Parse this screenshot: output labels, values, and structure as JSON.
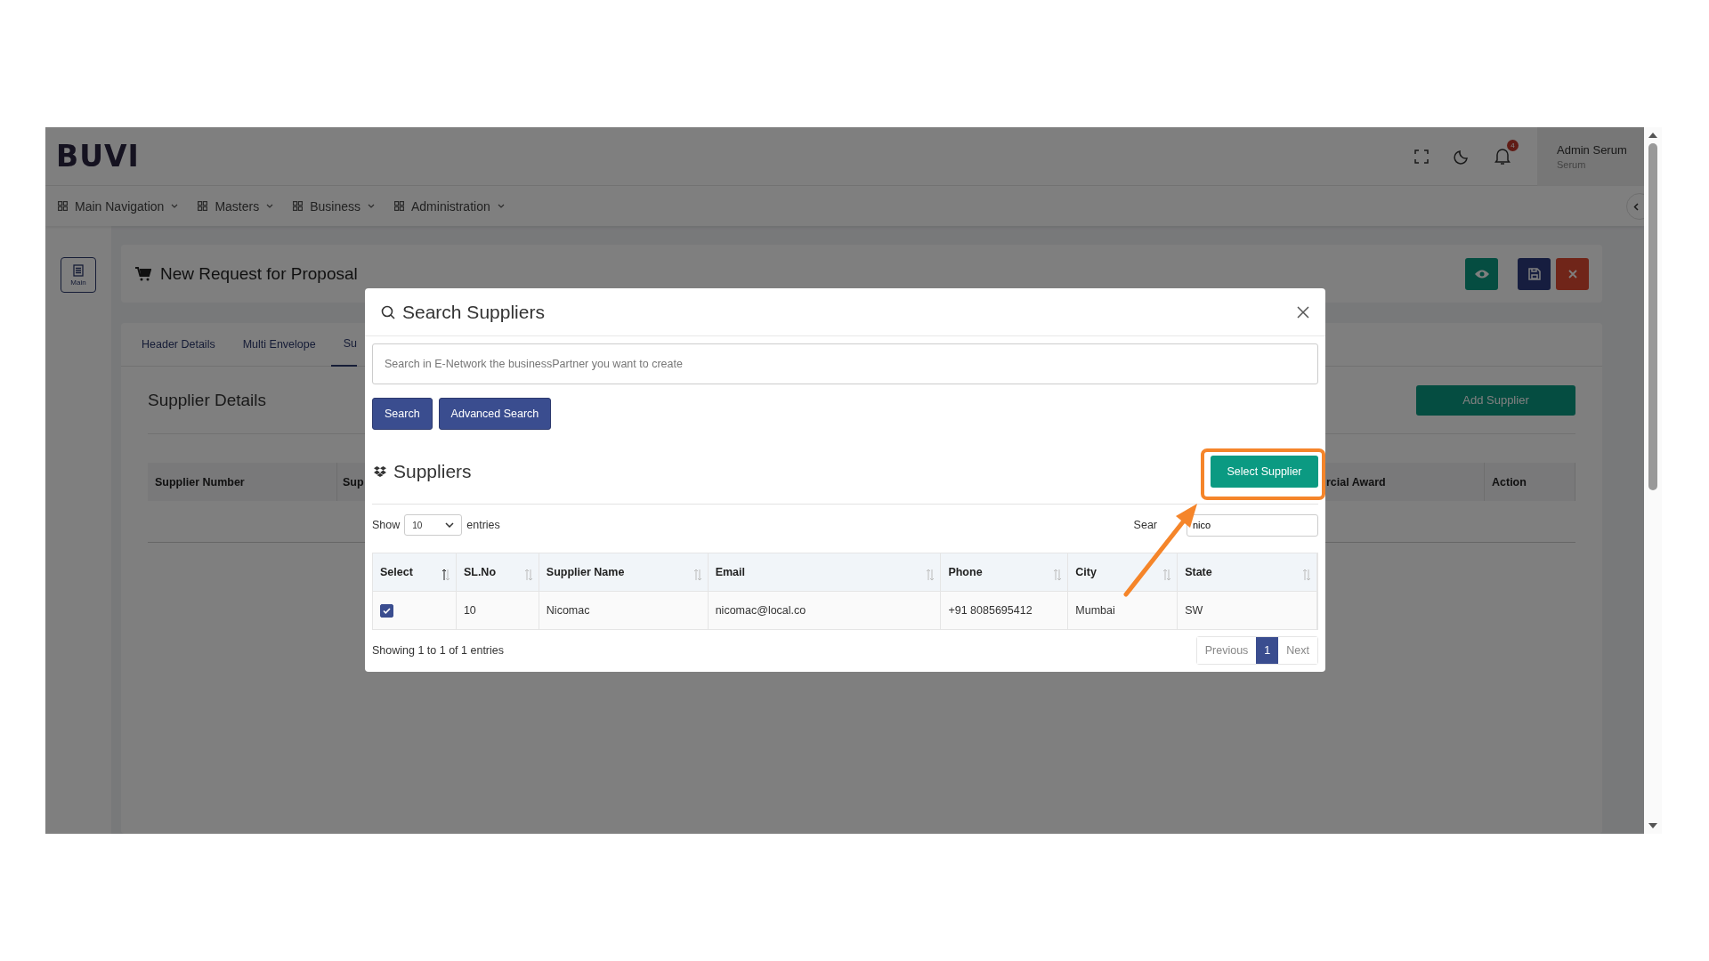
{
  "app": {
    "logo": "BUVI",
    "notifications": "4",
    "user": {
      "name": "Admin Serum",
      "role": "Serum"
    }
  },
  "nav": [
    {
      "label": "Main Navigation"
    },
    {
      "label": "Masters"
    },
    {
      "label": "Business"
    },
    {
      "label": "Administration"
    }
  ],
  "sidebar": {
    "button": "Main"
  },
  "page": {
    "title": "New Request for Proposal",
    "actions": [
      {
        "kind": "view"
      },
      {
        "kind": "save"
      },
      {
        "kind": "close"
      }
    ]
  },
  "tabs": [
    {
      "label": "Header Details",
      "selected": false
    },
    {
      "label": "Multi Envelope",
      "selected": false
    },
    {
      "label": "Su",
      "selected": true
    }
  ],
  "section": {
    "title": "Supplier Details",
    "add_button": "Add Supplier",
    "columns": [
      "Supplier Number",
      "Sup",
      "rcial Award",
      "Action"
    ]
  },
  "modal": {
    "title": "Search Suppliers",
    "search_placeholder": "Search in E-Network the businessPartner you want to create",
    "buttons": [
      "Search",
      "Advanced Search"
    ],
    "list_title": "Suppliers",
    "select_button": "Select Supplier",
    "show_label": "Show",
    "page_size": "10",
    "entries_label": "entries",
    "filter_label": "Sear",
    "filter_value": "nico",
    "columns": [
      {
        "label": "Select",
        "sorted": true
      },
      {
        "label": "SL.No",
        "sorted": false
      },
      {
        "label": "Supplier Name",
        "sorted": false
      },
      {
        "label": "Email",
        "sorted": false
      },
      {
        "label": "Phone",
        "sorted": false
      },
      {
        "label": "City",
        "sorted": false
      },
      {
        "label": "State",
        "sorted": false
      }
    ],
    "rows": [
      {
        "selected": true,
        "cells": [
          "",
          "10",
          "Nicomac",
          "nicomac@local.co",
          "+91 8085695412",
          "Mumbai",
          "SW"
        ]
      }
    ],
    "info": "Showing 1 to 1 of 1 entries",
    "pagination": [
      {
        "label": "Previous",
        "selected": false
      },
      {
        "label": "1",
        "selected": true
      },
      {
        "label": "Next",
        "selected": false
      }
    ]
  }
}
